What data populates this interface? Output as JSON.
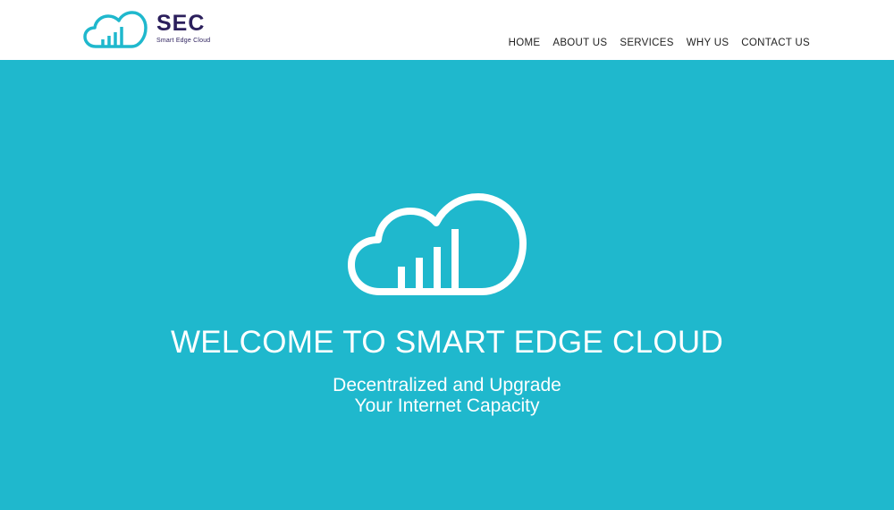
{
  "brand": {
    "name": "SEC",
    "tagline": "Smart Edge Cloud",
    "accent_color": "#1fb8cd",
    "text_color": "#2b1f5c",
    "logo_icon": "cloud-signal-icon"
  },
  "nav": {
    "items": [
      {
        "label": "HOME"
      },
      {
        "label": "ABOUT US"
      },
      {
        "label": "SERVICES"
      },
      {
        "label": "WHY US"
      },
      {
        "label": "CONTACT US"
      }
    ]
  },
  "hero": {
    "background_color": "#1fb8cd",
    "icon": "cloud-signal-icon",
    "title": "WELCOME TO SMART EDGE CLOUD",
    "subtitle_line1": "Decentralized and Upgrade",
    "subtitle_line2": "Your Internet Capacity"
  }
}
